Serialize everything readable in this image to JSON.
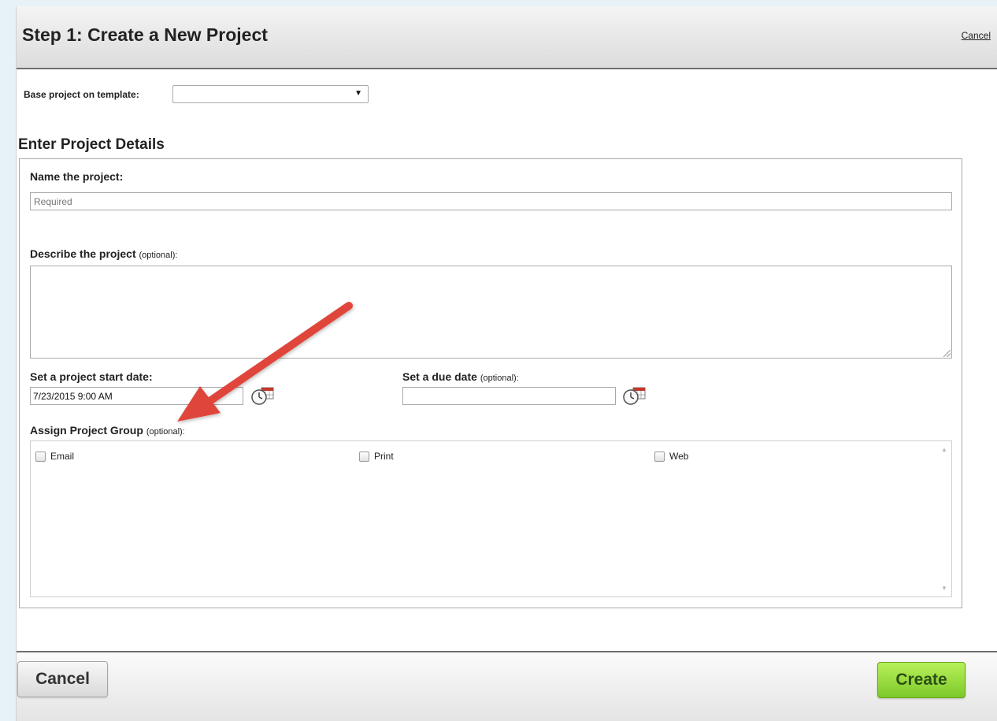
{
  "dialog": {
    "title": "Step 1: Create a New Project",
    "header_cancel": "Cancel"
  },
  "template": {
    "label": "Base project on template:",
    "selected": ""
  },
  "details": {
    "section_title": "Enter Project Details",
    "name_label": "Name the project:",
    "name_placeholder": "Required",
    "describe_label": "Describe the project",
    "describe_optional": "(optional):",
    "start_label": "Set a project start date:",
    "start_value": "7/23/2015 9:00 AM",
    "due_label": "Set a due date",
    "due_optional": "(optional):",
    "due_value": "",
    "group_label": "Assign Project Group",
    "group_optional": "(optional):",
    "groups": [
      {
        "label": "Email",
        "checked": false
      },
      {
        "label": "Print",
        "checked": false
      },
      {
        "label": "Web",
        "checked": false
      }
    ]
  },
  "footer": {
    "cancel_label": "Cancel",
    "create_label": "Create"
  },
  "colors": {
    "required_text": "#b32121",
    "create_button": "#8fd63a",
    "annotation_arrow": "#e0453a"
  },
  "icons": {
    "calendar_clock": "calendar-clock-icon",
    "select_arrow": "dropdown-arrow-icon"
  }
}
